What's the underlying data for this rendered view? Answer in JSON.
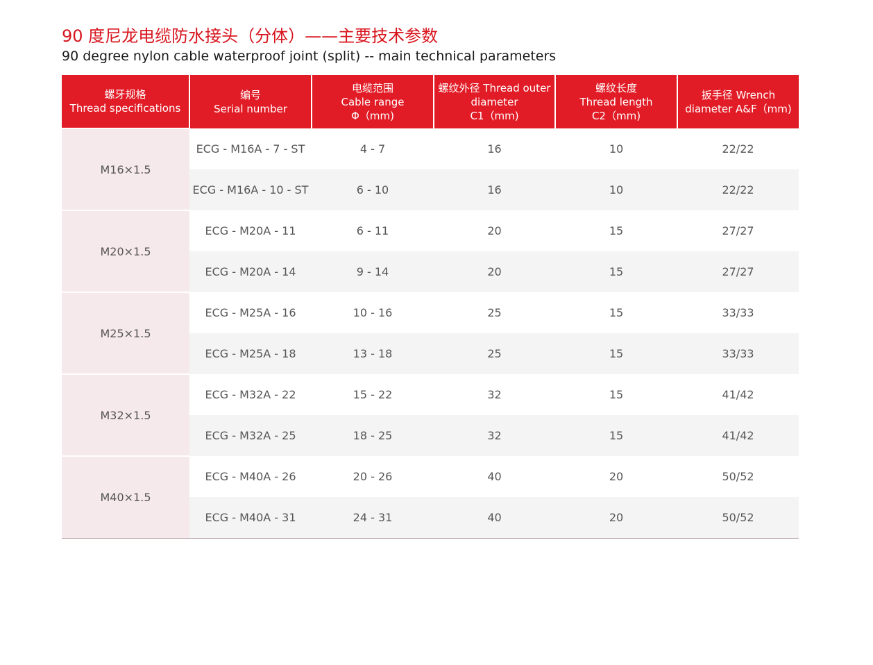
{
  "title_cn": "90 度尼龙电缆防水接头（分体）——主要技术参数",
  "title_en": "90 degree nylon cable waterproof joint (split) -- main technical parameters",
  "headers": [
    [
      "螺牙规格",
      "Thread specifications"
    ],
    [
      "编号",
      "Serial number"
    ],
    [
      "电缆范围",
      "Cable range",
      "Φ（mm)"
    ],
    [
      "螺纹外径 Thread outer",
      "diameter",
      "C1（mm)"
    ],
    [
      "螺纹长度",
      "Thread length",
      "C2（mm)"
    ],
    [
      "扳手径 Wrench",
      "diameter A&F（mm)"
    ]
  ],
  "groups": [
    {
      "thread": "M16×1.5",
      "rows": [
        {
          "serial": "ECG - M16A - 7 - ST",
          "cable": "4 - 7",
          "c1": "16",
          "c2": "10",
          "af": "22/22"
        },
        {
          "serial": "ECG - M16A - 10 - ST",
          "cable": "6 - 10",
          "c1": "16",
          "c2": "10",
          "af": "22/22"
        }
      ]
    },
    {
      "thread": "M20×1.5",
      "rows": [
        {
          "serial": "ECG - M20A - 11",
          "cable": "6 - 11",
          "c1": "20",
          "c2": "15",
          "af": "27/27"
        },
        {
          "serial": "ECG - M20A - 14",
          "cable": "9 - 14",
          "c1": "20",
          "c2": "15",
          "af": "27/27"
        }
      ]
    },
    {
      "thread": "M25×1.5",
      "rows": [
        {
          "serial": "ECG - M25A - 16",
          "cable": "10 - 16",
          "c1": "25",
          "c2": "15",
          "af": "33/33"
        },
        {
          "serial": "ECG - M25A - 18",
          "cable": "13 - 18",
          "c1": "25",
          "c2": "15",
          "af": "33/33"
        }
      ]
    },
    {
      "thread": "M32×1.5",
      "rows": [
        {
          "serial": "ECG - M32A - 22",
          "cable": "15 - 22",
          "c1": "32",
          "c2": "15",
          "af": "41/42"
        },
        {
          "serial": "ECG - M32A - 25",
          "cable": "18 - 25",
          "c1": "32",
          "c2": "15",
          "af": "41/42"
        }
      ]
    },
    {
      "thread": "M40×1.5",
      "rows": [
        {
          "serial": "ECG - M40A - 26",
          "cable": "20 - 26",
          "c1": "40",
          "c2": "20",
          "af": "50/52"
        },
        {
          "serial": "ECG - M40A - 31",
          "cable": "24 - 31",
          "c1": "40",
          "c2": "20",
          "af": "50/52"
        }
      ]
    }
  ],
  "colors": {
    "accent_red": "#e21c26",
    "title_red": "#d8151e",
    "thread_cell_bg": "#f6e9ec",
    "alt_row_bg": "#f4f4f4"
  }
}
